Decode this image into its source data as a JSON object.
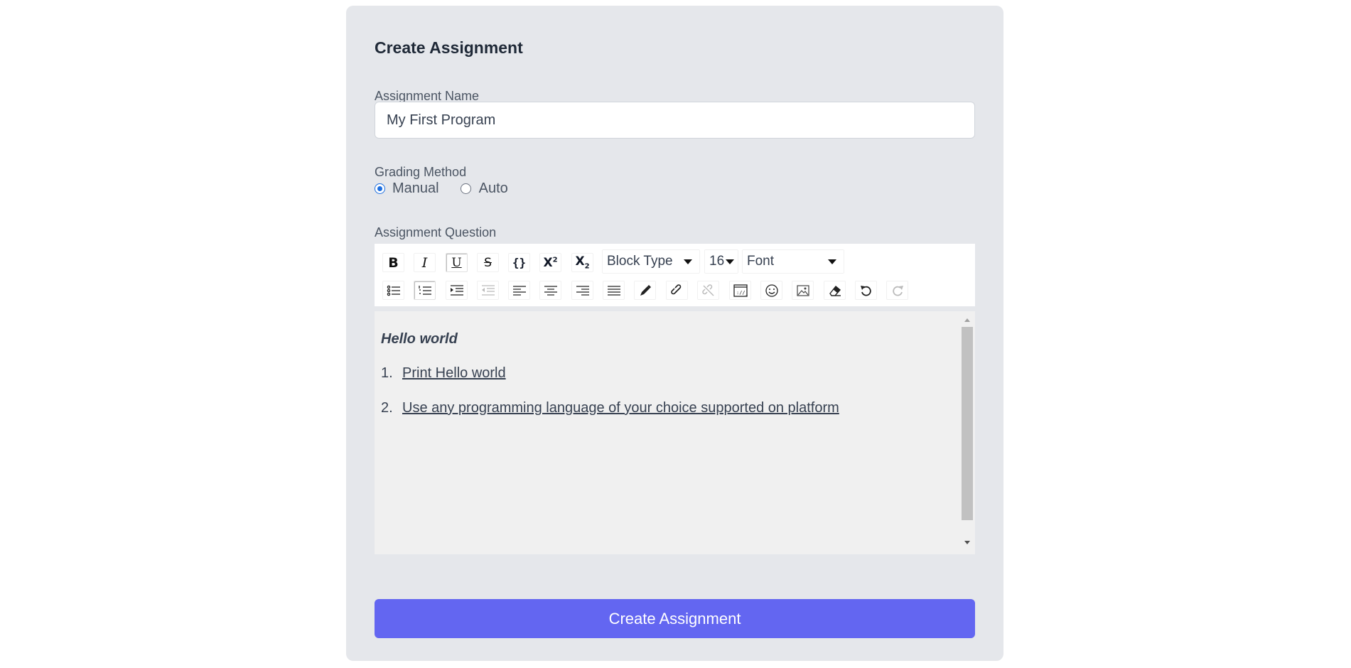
{
  "form": {
    "title": "Create Assignment",
    "name_label": "Assignment Name",
    "name_value": "My First Program",
    "grading_label": "Grading Method",
    "grading_options": [
      {
        "label": "Manual",
        "checked": true
      },
      {
        "label": "Auto",
        "checked": false
      }
    ],
    "question_label": "Assignment Question",
    "submit_label": "Create Assignment"
  },
  "toolbar": {
    "row1": [
      "bold-icon",
      "italic-icon",
      "underline-icon",
      "strikethrough-icon",
      "code-icon",
      "superscript-icon",
      "subscript-icon"
    ],
    "block_type": "Block Type",
    "font_size": "16",
    "font": "Font",
    "row2": [
      "unordered-list-icon",
      "ordered-list-icon",
      "indent-icon",
      "outdent-icon",
      "align-left-icon",
      "align-center-icon",
      "align-right-icon",
      "justify-icon",
      "color-picker-icon",
      "link-icon",
      "unlink-icon",
      "embed-icon",
      "emoji-icon",
      "image-icon",
      "eraser-icon",
      "undo-icon",
      "redo-icon"
    ]
  },
  "editor": {
    "heading": "Hello world",
    "items": [
      {
        "num": "1.",
        "text": "Print Hello world"
      },
      {
        "num": "2.",
        "text": "Use any programming language of your choice supported on platform"
      }
    ]
  },
  "colors": {
    "card_bg": "#e5e7eb",
    "primary": "#6366f1",
    "radio_accent": "#1d6fe0",
    "editor_bg": "#f0f0f0"
  }
}
